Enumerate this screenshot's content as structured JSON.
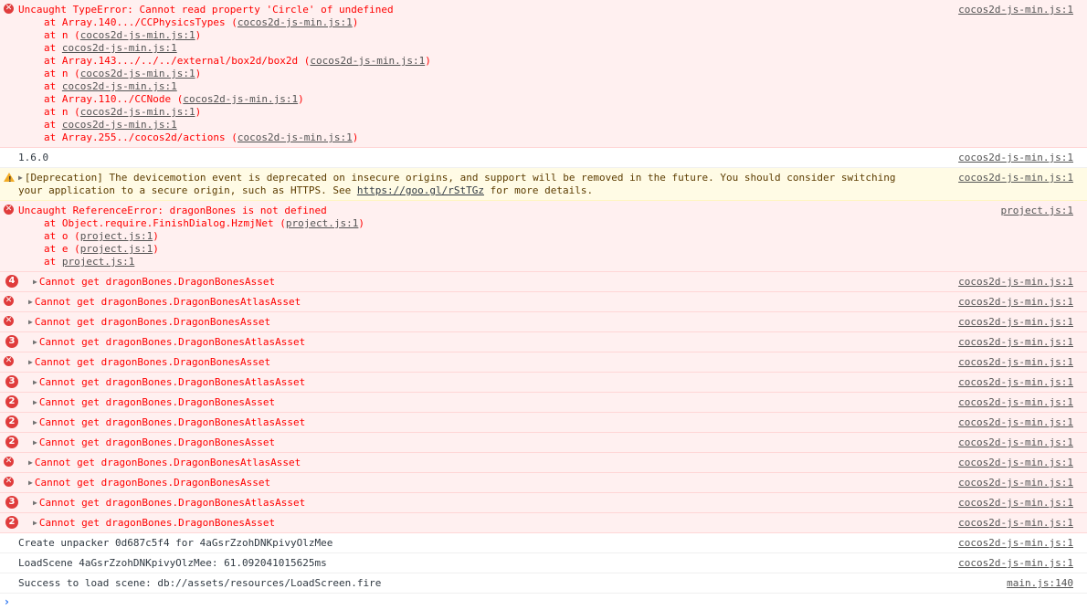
{
  "colors": {
    "error_bg": "#fff0f0",
    "error_text": "#ff0000",
    "warning_bg": "#fffbe5",
    "accent": "#367cf1"
  },
  "icons": {
    "error": "error-circle-icon",
    "warning": "warning-triangle-icon",
    "expand": "disclosure-triangle-icon",
    "prompt": "prompt-chevron-icon"
  },
  "msg1": {
    "text": "Uncaught TypeError: Cannot read property 'Circle' of undefined",
    "source": "cocos2d-js-min.js:1",
    "stack": [
      {
        "pre": "at Array.140.../CCPhysicsTypes (",
        "link": "cocos2d-js-min.js:1",
        "post": ")"
      },
      {
        "pre": "at n (",
        "link": "cocos2d-js-min.js:1",
        "post": ")"
      },
      {
        "pre": "at ",
        "link": "cocos2d-js-min.js:1",
        "post": ""
      },
      {
        "pre": "at Array.143.../../../external/box2d/box2d (",
        "link": "cocos2d-js-min.js:1",
        "post": ")"
      },
      {
        "pre": "at n (",
        "link": "cocos2d-js-min.js:1",
        "post": ")"
      },
      {
        "pre": "at ",
        "link": "cocos2d-js-min.js:1",
        "post": ""
      },
      {
        "pre": "at Array.110../CCNode (",
        "link": "cocos2d-js-min.js:1",
        "post": ")"
      },
      {
        "pre": "at n (",
        "link": "cocos2d-js-min.js:1",
        "post": ")"
      },
      {
        "pre": "at ",
        "link": "cocos2d-js-min.js:1",
        "post": ""
      },
      {
        "pre": "at Array.255../cocos2d/actions (",
        "link": "cocos2d-js-min.js:1",
        "post": ")"
      }
    ]
  },
  "msg2": {
    "text": "1.6.0",
    "source": "cocos2d-js-min.js:1"
  },
  "msg3": {
    "text_pre": "[Deprecation] The devicemotion event is deprecated on insecure origins, and support will be removed in the future. You should consider switching your application to a secure origin, such as HTTPS. See ",
    "link": "https://goo.gl/rStTGz",
    "text_post": " for more details.",
    "source": "cocos2d-js-min.js:1"
  },
  "msg4": {
    "text": "Uncaught ReferenceError: dragonBones is not defined",
    "source": "project.js:1",
    "stack": [
      {
        "pre": "at Object.require.FinishDialog.HzmjNet (",
        "link": "project.js:1",
        "post": ")"
      },
      {
        "pre": "at o (",
        "link": "project.js:1",
        "post": ")"
      },
      {
        "pre": "at e (",
        "link": "project.js:1",
        "post": ")"
      },
      {
        "pre": "at ",
        "link": "project.js:1",
        "post": ""
      }
    ]
  },
  "grouped": [
    {
      "count": "4",
      "text": "Cannot get dragonBones.DragonBonesAsset",
      "source": "cocos2d-js-min.js:1"
    },
    {
      "count": "",
      "text": "Cannot get dragonBones.DragonBonesAtlasAsset",
      "source": "cocos2d-js-min.js:1"
    },
    {
      "count": "",
      "text": "Cannot get dragonBones.DragonBonesAsset",
      "source": "cocos2d-js-min.js:1"
    },
    {
      "count": "3",
      "text": "Cannot get dragonBones.DragonBonesAtlasAsset",
      "source": "cocos2d-js-min.js:1"
    },
    {
      "count": "",
      "text": "Cannot get dragonBones.DragonBonesAsset",
      "source": "cocos2d-js-min.js:1"
    },
    {
      "count": "3",
      "text": "Cannot get dragonBones.DragonBonesAtlasAsset",
      "source": "cocos2d-js-min.js:1"
    },
    {
      "count": "2",
      "text": "Cannot get dragonBones.DragonBonesAsset",
      "source": "cocos2d-js-min.js:1"
    },
    {
      "count": "2",
      "text": "Cannot get dragonBones.DragonBonesAtlasAsset",
      "source": "cocos2d-js-min.js:1"
    },
    {
      "count": "2",
      "text": "Cannot get dragonBones.DragonBonesAsset",
      "source": "cocos2d-js-min.js:1"
    },
    {
      "count": "",
      "text": "Cannot get dragonBones.DragonBonesAtlasAsset",
      "source": "cocos2d-js-min.js:1"
    },
    {
      "count": "",
      "text": "Cannot get dragonBones.DragonBonesAsset",
      "source": "cocos2d-js-min.js:1"
    },
    {
      "count": "3",
      "text": "Cannot get dragonBones.DragonBonesAtlasAsset",
      "source": "cocos2d-js-min.js:1"
    },
    {
      "count": "2",
      "text": "Cannot get dragonBones.DragonBonesAsset",
      "source": "cocos2d-js-min.js:1"
    }
  ],
  "logs": [
    {
      "text": "Create unpacker 0d687c5f4 for 4aGsrZzohDNKpivyOlzMee",
      "source": "cocos2d-js-min.js:1"
    },
    {
      "text": "LoadScene 4aGsrZzohDNKpivyOlzMee: 61.092041015625ms",
      "source": "cocos2d-js-min.js:1"
    },
    {
      "text": "Success to load scene: db://assets/resources/LoadScreen.fire",
      "source": "main.js:140"
    }
  ],
  "prompt": {
    "caret": "›"
  }
}
